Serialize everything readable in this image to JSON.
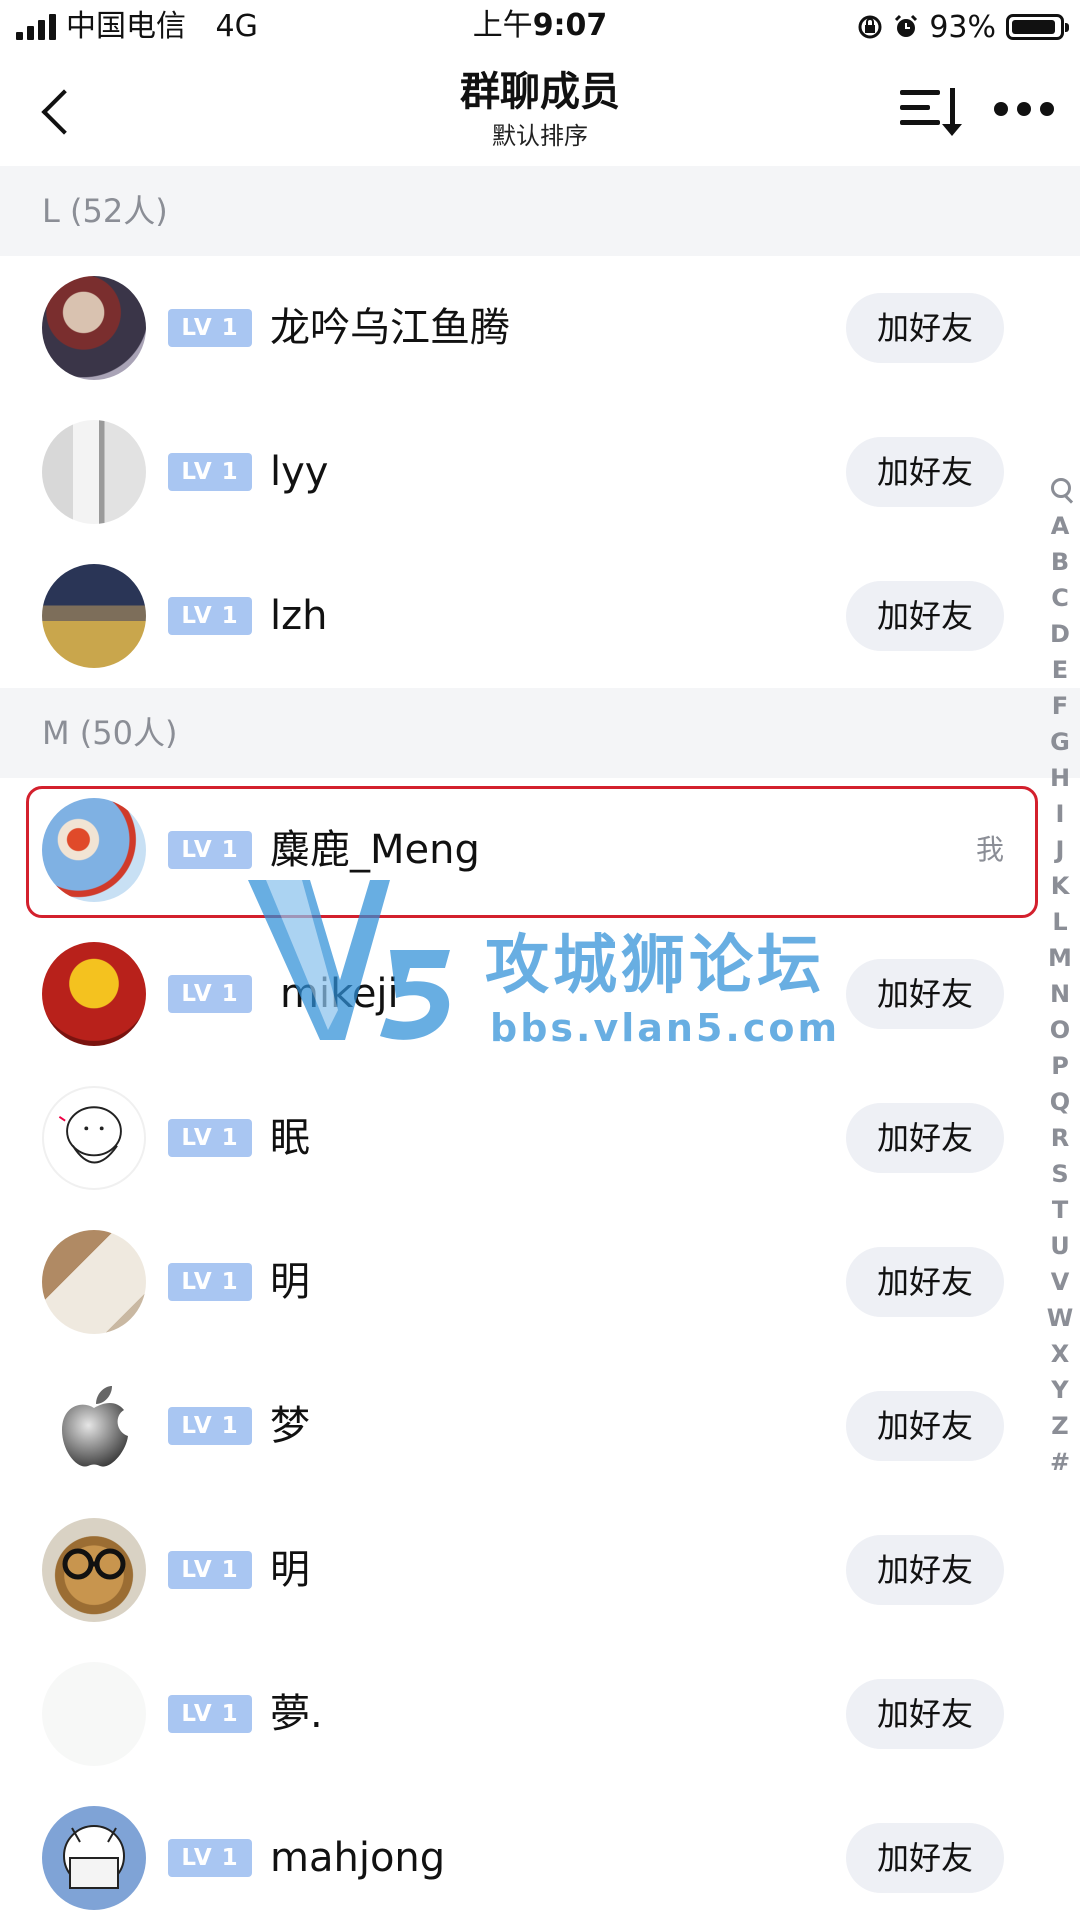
{
  "status_bar": {
    "carrier": "中国电信",
    "network": "4G",
    "time_prefix": "上午",
    "time": "9:07",
    "battery_percent": "93%",
    "battery_level": 0.93
  },
  "navbar": {
    "title": "群聊成员",
    "subtitle": "默认排序",
    "icons": {
      "back": "chevron-left-icon",
      "sort": "sort-icon",
      "more": "more-icon"
    }
  },
  "sections": [
    {
      "header": "L (52人)",
      "members": [
        {
          "level": "LV 1",
          "name": "龙吟乌江鱼腾",
          "action": "加好友"
        },
        {
          "level": "LV 1",
          "name": "lyy",
          "action": "加好友"
        },
        {
          "level": "LV 1",
          "name": "lzh",
          "action": "加好友"
        }
      ]
    },
    {
      "header": "M (50人)",
      "members": [
        {
          "level": "LV 1",
          "name": "麋鹿_Meng",
          "self_label": "我"
        },
        {
          "level": "LV 1",
          "name": "mikeji",
          "action": "加好友"
        },
        {
          "level": "LV 1",
          "name": "眠",
          "action": "加好友"
        },
        {
          "level": "LV 1",
          "name": "明",
          "action": "加好友"
        },
        {
          "level": "LV 1",
          "name": "梦",
          "action": "加好友"
        },
        {
          "level": "LV 1",
          "name": "明",
          "action": "加好友"
        },
        {
          "level": "LV 1",
          "name": "夢.",
          "action": "加好友"
        },
        {
          "level": "LV 1",
          "name": "mahjong",
          "action": "加好友"
        }
      ]
    }
  ],
  "index_letters": [
    "A",
    "B",
    "C",
    "D",
    "E",
    "F",
    "G",
    "H",
    "I",
    "J",
    "K",
    "L",
    "M",
    "N",
    "O",
    "P",
    "Q",
    "R",
    "S",
    "T",
    "U",
    "V",
    "W",
    "X",
    "Y",
    "Z",
    "#"
  ],
  "watermark": {
    "logo_text": "V5",
    "title": "攻城狮论坛",
    "url": "bbs.vlan5.com"
  },
  "colors": {
    "badge": "#a9c6f2",
    "section_bg": "#f4f5f7",
    "add_button_bg": "#eef0f5",
    "highlight": "#d3202d",
    "watermark": "#2f8fd8"
  }
}
